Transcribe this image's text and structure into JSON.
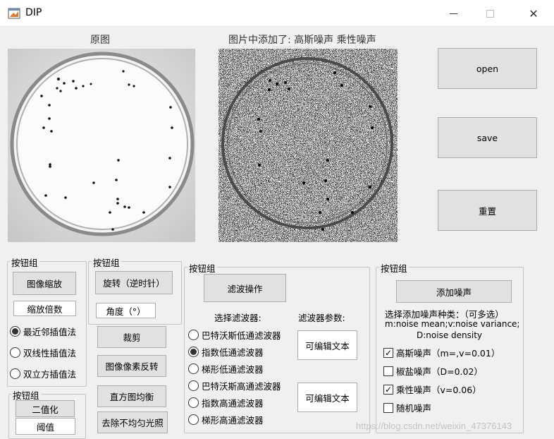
{
  "window": {
    "title": "DIP",
    "minimize_glyph": "—",
    "close_glyph": "✕"
  },
  "images": {
    "original_caption": "原图",
    "noisy_caption": "图片中添加了: 高斯噪声 乘性噪声"
  },
  "right_buttons": {
    "open": "open",
    "save": "save",
    "reset": "重置"
  },
  "scale_group": {
    "title": "按钮组",
    "scale_button": "图像缩放",
    "scale_factor_field": "缩放倍数",
    "options": [
      "最近邻插值法",
      "双线性插值法",
      "双立方插值法"
    ],
    "selected_index": 0
  },
  "rotate_group": {
    "title": "按钮组",
    "rotate_button": "旋转（逆时针）",
    "angle_field": "角度（°）"
  },
  "tools": {
    "crop": "裁剪",
    "invert": "图像像素反转",
    "histeq": "直方图均衡",
    "uneven_light": "去除不均匀光照"
  },
  "binary_group": {
    "title": "按钮组",
    "binarize_button": "二值化",
    "threshold_field": "阈值"
  },
  "filter_group": {
    "title": "按钮组",
    "filter_button": "滤波操作",
    "choose_label": "选择滤波器:",
    "params_label": "滤波器参数:",
    "options": [
      "巴特沃斯低通滤波器",
      "指数低通滤波器",
      "梯形低通滤波器",
      "巴特沃斯高通滤波器",
      "指数高通滤波器",
      "梯形高通滤波器"
    ],
    "selected_index": 1,
    "param1": "可编辑文本",
    "param2": "可编辑文本"
  },
  "noise_group": {
    "title": "按钮组",
    "add_button": "添加噪声",
    "hint_line1": "选择添加噪声种类：（可多选）",
    "hint_line2": "m:noise mean;v:noise variance;",
    "hint_line3": "D:noise density",
    "options": [
      {
        "label": "高斯噪声（m=,v=0.01）",
        "checked": true
      },
      {
        "label": "椒盐噪声（D=0.02）",
        "checked": false
      },
      {
        "label": "乘性噪声（v=0.06）",
        "checked": true
      },
      {
        "label": "随机噪声",
        "checked": false
      }
    ]
  },
  "watermark": "https://blog.csdn.net/weixin_47376143"
}
